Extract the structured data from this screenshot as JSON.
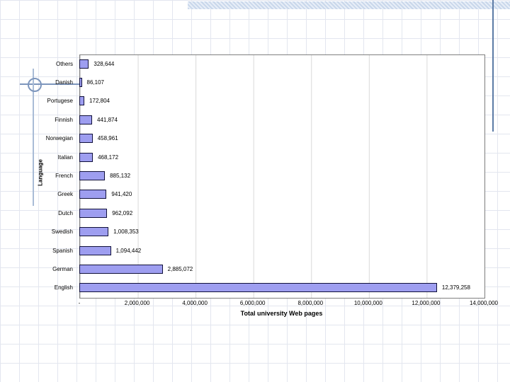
{
  "theme": {
    "grid_color": "#e3e6ef",
    "ornament_color": "#7d96bd",
    "accent_line_color": "#5c7ba6",
    "plot_border_color": "#7f7f7f",
    "plot_gridline_color": "#d9d9d9"
  },
  "chart_data": {
    "type": "bar",
    "orientation": "horizontal",
    "title": "",
    "xlabel": "Total university Web pages",
    "ylabel": "Language",
    "categories": [
      "Others",
      "Danish",
      "Portugese",
      "Finnish",
      "Norwegian",
      "Italian",
      "French",
      "Greek",
      "Dutch",
      "Swedish",
      "Spanish",
      "German",
      "English"
    ],
    "values": [
      328644,
      86107,
      172804,
      441874,
      458961,
      468172,
      885132,
      941420,
      962092,
      1008353,
      1094442,
      2885072,
      12379258
    ],
    "value_labels": [
      "328,644",
      "86,107",
      "172,804",
      "441,874",
      "458,961",
      "468,172",
      "885,132",
      "941,420",
      "962,092",
      "1,008,353",
      "1,094,442",
      "2,885,072",
      "12,379,258"
    ],
    "xlim": [
      0,
      14000000
    ],
    "x_ticks": [
      "-",
      "2,000,000",
      "4,000,000",
      "6,000,000",
      "8,000,000",
      "10,000,000",
      "12,000,000",
      "14,000,000"
    ],
    "bar_color": "#9e9ef0",
    "bar_border_color": "#10103a",
    "grid": true,
    "legend": "none"
  }
}
